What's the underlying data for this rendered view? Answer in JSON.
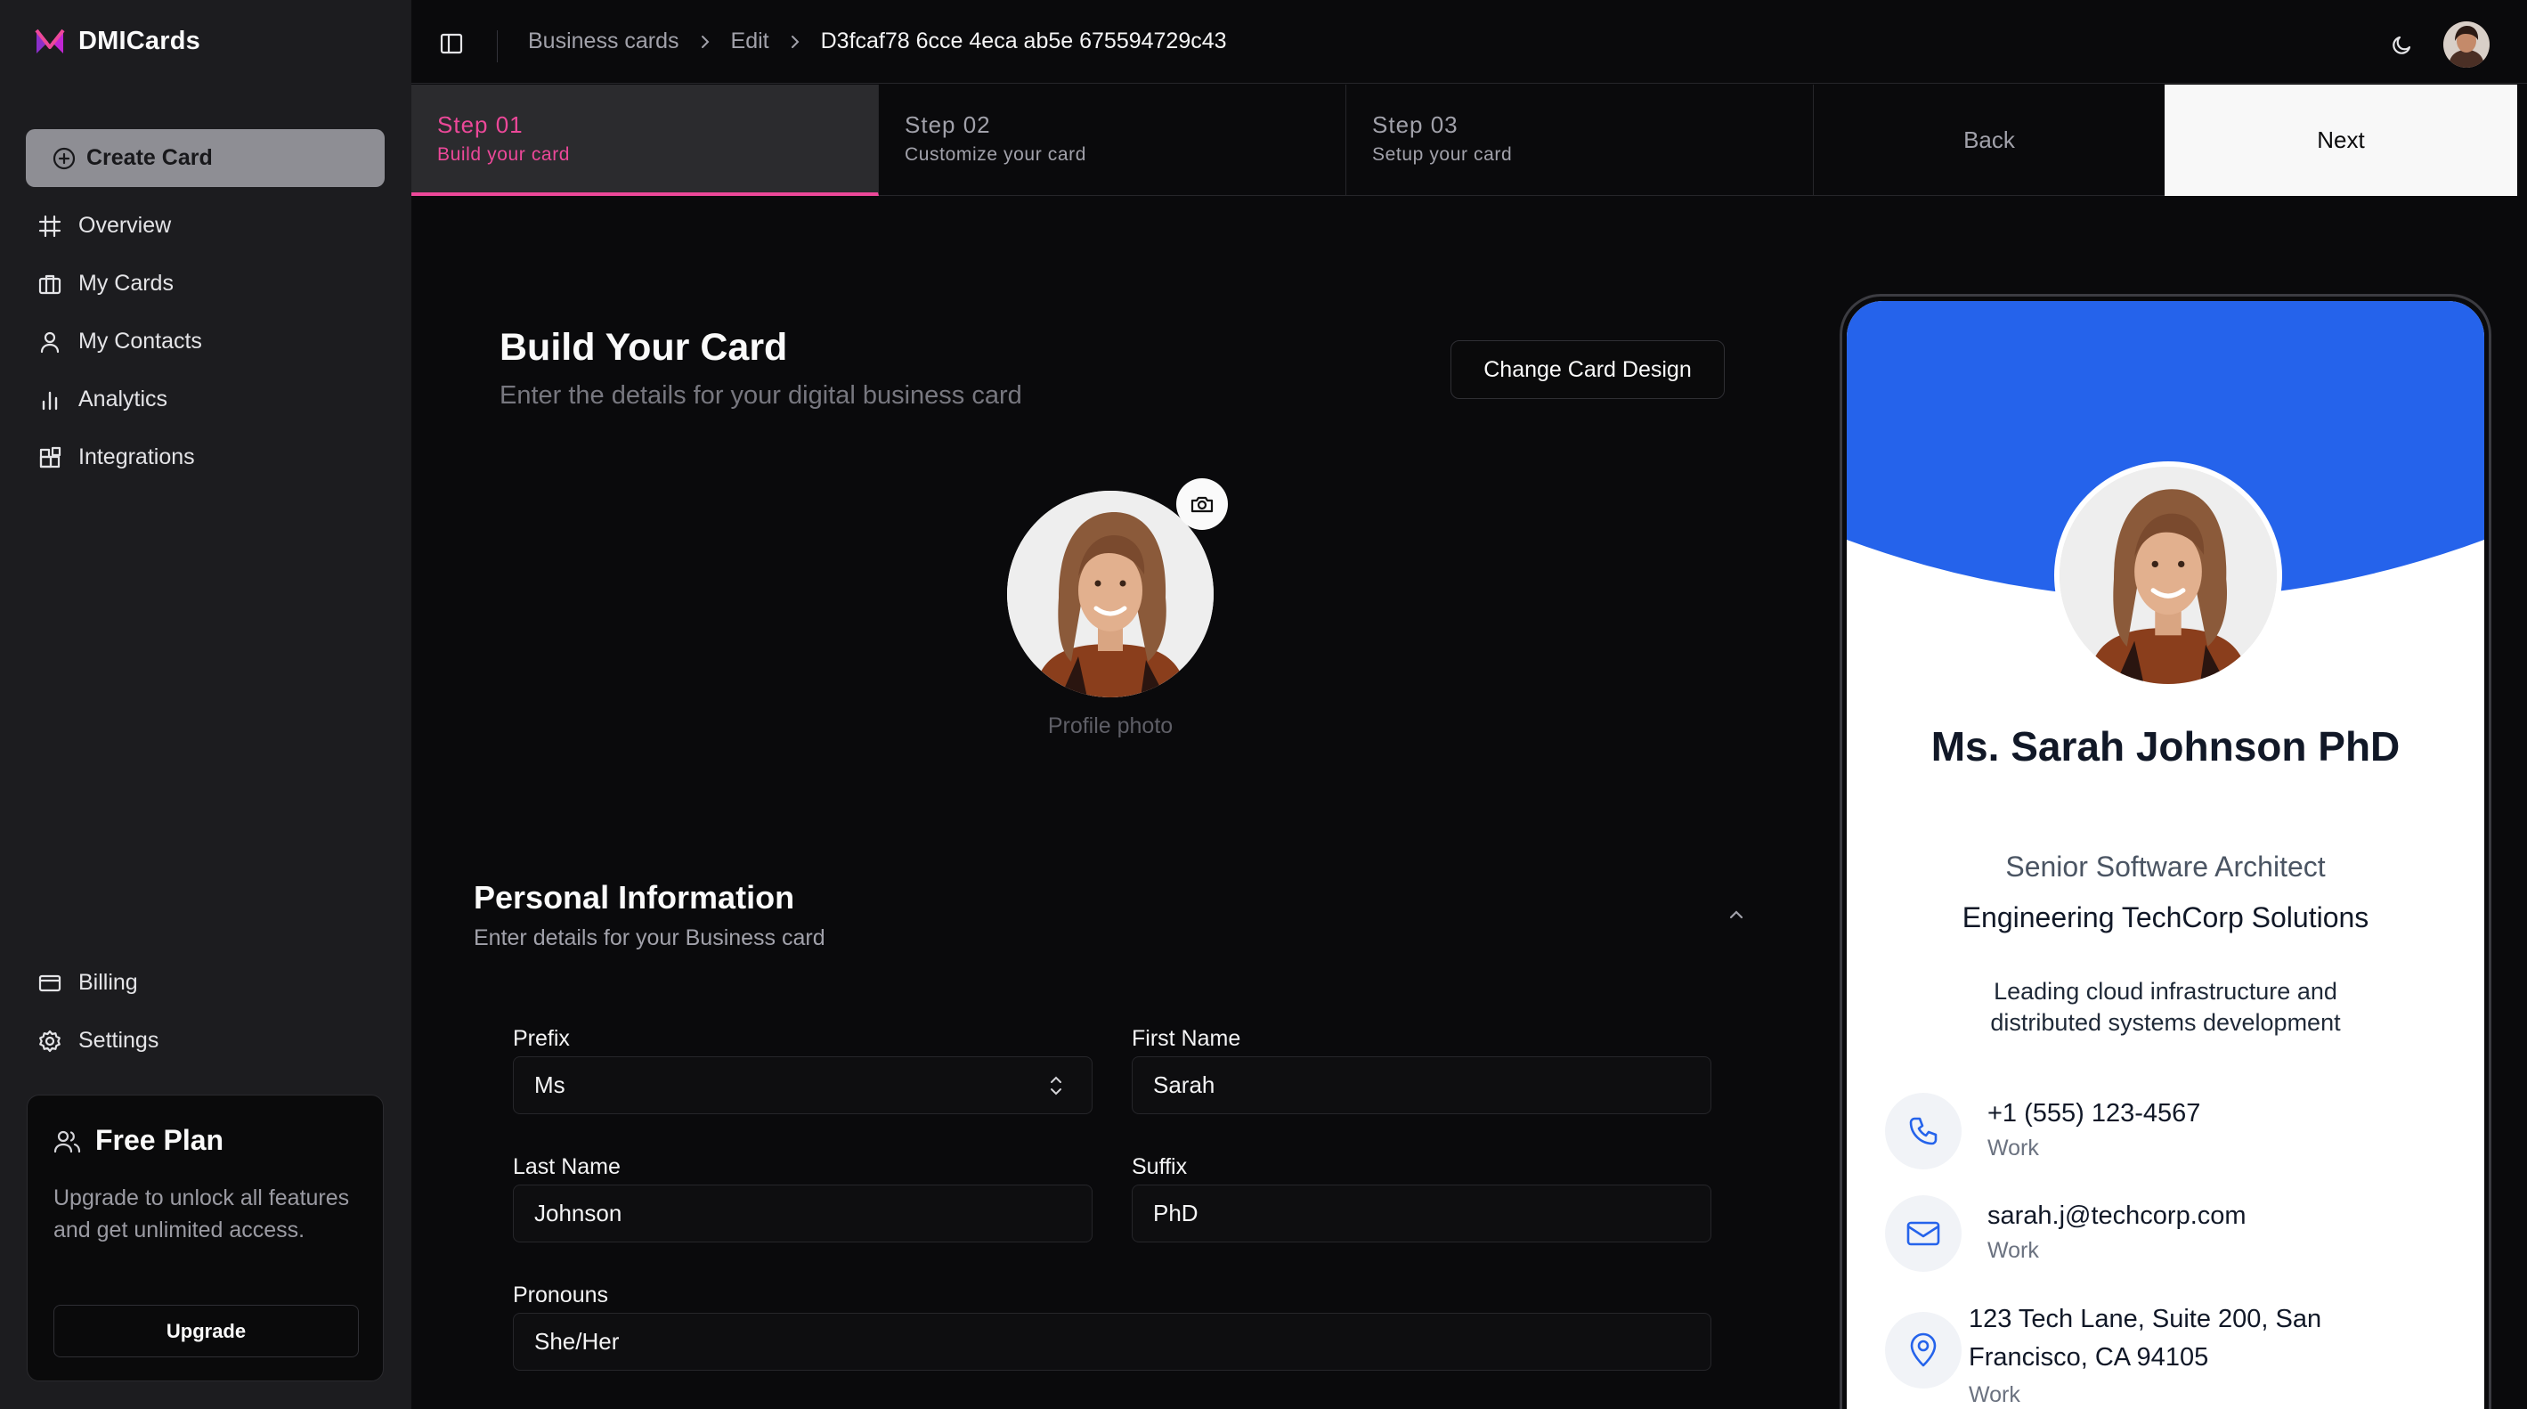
{
  "app": {
    "name": "DMICards"
  },
  "colors": {
    "accent": "#ec4899",
    "card_blue": "#2563eb",
    "sidebar_bg": "#1c1c1f"
  },
  "sidebar": {
    "create_label": "Create Card",
    "nav": [
      {
        "label": "Overview",
        "icon": "hash-icon"
      },
      {
        "label": "My Cards",
        "icon": "briefcase-icon"
      },
      {
        "label": "My Contacts",
        "icon": "user-icon"
      },
      {
        "label": "Analytics",
        "icon": "bar-chart-icon"
      },
      {
        "label": "Integrations",
        "icon": "blocks-icon"
      }
    ],
    "bottom_nav": [
      {
        "label": "Billing",
        "icon": "credit-card-icon"
      },
      {
        "label": "Settings",
        "icon": "gear-icon"
      }
    ],
    "plan": {
      "title": "Free Plan",
      "description": "Upgrade to unlock all features and get unlimited access.",
      "button": "Upgrade"
    }
  },
  "header": {
    "breadcrumbs": [
      "Business cards",
      "Edit",
      "D3fcaf78 6cce 4eca ab5e 675594729c43"
    ]
  },
  "steps": [
    {
      "num": "Step 01",
      "label": "Build your card",
      "active": true
    },
    {
      "num": "Step 02",
      "label": "Customize your card",
      "active": false
    },
    {
      "num": "Step 03",
      "label": "Setup your card",
      "active": false
    }
  ],
  "nav_buttons": {
    "back": "Back",
    "next": "Next"
  },
  "form": {
    "title": "Build Your Card",
    "subtitle": "Enter the details for your digital business card",
    "change_design": "Change Card Design",
    "profile_label": "Profile photo",
    "section": {
      "title": "Personal Information",
      "subtitle": "Enter details for your Business card"
    },
    "fields": {
      "prefix": {
        "label": "Prefix",
        "value": "Ms"
      },
      "first_name": {
        "label": "First Name",
        "value": "Sarah"
      },
      "last_name": {
        "label": "Last Name",
        "value": "Johnson"
      },
      "suffix": {
        "label": "Suffix",
        "value": "PhD"
      },
      "pronouns": {
        "label": "Pronouns",
        "value": "She/Her"
      }
    }
  },
  "preview": {
    "name": "Ms. Sarah Johnson PhD",
    "role": "Senior Software Architect",
    "company": "Engineering TechCorp Solutions",
    "bio": "Leading cloud infrastructure and distributed systems development",
    "contacts": [
      {
        "icon": "phone-icon",
        "value": "+1 (555) 123-4567",
        "type": "Work"
      },
      {
        "icon": "mail-icon",
        "value": "sarah.j@techcorp.com",
        "type": "Work"
      },
      {
        "icon": "map-pin-icon",
        "value": "123 Tech Lane, Suite 200, San Francisco, CA 94105",
        "type": "Work"
      }
    ]
  }
}
